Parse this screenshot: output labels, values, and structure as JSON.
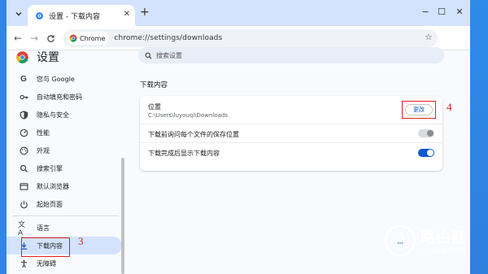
{
  "tab": {
    "title": "设置 - 下载内容"
  },
  "toolbar": {
    "site_chip": "Chrome",
    "url": "chrome://settings/downloads"
  },
  "settings": {
    "brand": "设置",
    "search_placeholder": "搜索设置",
    "nav": [
      {
        "label": "您与 Google",
        "icon": "google-icon"
      },
      {
        "label": "自动填充和密码",
        "icon": "key-icon"
      },
      {
        "label": "隐私与安全",
        "icon": "shield-icon"
      },
      {
        "label": "性能",
        "icon": "speedometer-icon"
      },
      {
        "label": "外观",
        "icon": "palette-icon"
      },
      {
        "label": "搜索引擎",
        "icon": "search-icon"
      },
      {
        "label": "默认浏览器",
        "icon": "browser-icon"
      },
      {
        "label": "起始页面",
        "icon": "power-icon"
      },
      {
        "label": "语言",
        "icon": "translate-icon"
      },
      {
        "label": "下载内容",
        "icon": "download-icon",
        "active": true
      },
      {
        "label": "无障碍",
        "icon": "accessibility-icon"
      }
    ],
    "section_title": "下载内容",
    "location_label": "位置",
    "location_path": "C:\\Users\\luyouqi\\Downloads",
    "change_button": "更改",
    "ask_label": "下载前询问每个文件的保存位置",
    "ask_enabled": false,
    "show_label": "下载完成后显示下载内容",
    "show_enabled": true
  },
  "annotations": {
    "marker_3": "3",
    "marker_4": "4",
    "color": "#e02020"
  },
  "watermark": {
    "big": "路由器",
    "small": "luyouqi.com"
  },
  "colors": {
    "accent": "#0b57d0",
    "tabstrip": "#d3e3fd",
    "desktop": "#2f86e6"
  }
}
